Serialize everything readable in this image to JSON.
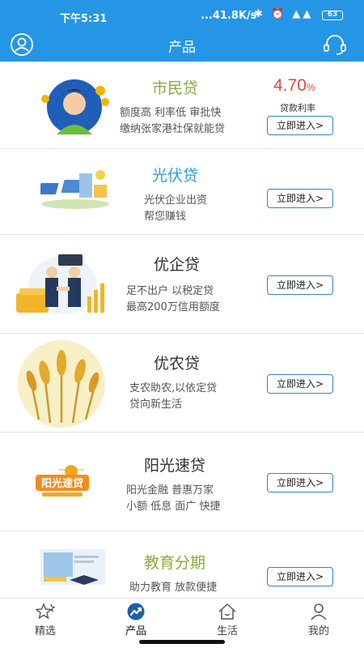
{
  "status_bar": {
    "time": "下午5:31",
    "network_speed": "...41.8K/s",
    "battery": "63"
  },
  "header": {
    "title": "产品"
  },
  "products": [
    {
      "name": "市民贷",
      "desc": [
        "额度高 利率低 审批快",
        "缴纳张家港社保就能贷"
      ],
      "button": "立即进入>",
      "rate": "4.70",
      "rate_unit": "%",
      "rate_label": "贷款利率",
      "name_color": "#8aab3c"
    },
    {
      "name": "光伏贷",
      "desc": [
        "光伏企业出资",
        "帮您赚钱"
      ],
      "button": "立即进入>",
      "name_color": "#2a9fd8"
    },
    {
      "name": "优企贷",
      "desc": [
        "足不出户 以税定贷",
        "最高200万信用额度"
      ],
      "button": "立即进入>",
      "name_color": "#333333"
    },
    {
      "name": "优农贷",
      "desc": [
        "支农助农,以依定贷",
        "贷向新生活"
      ],
      "button": "立即进入>",
      "name_color": "#333333"
    },
    {
      "name": "阳光速贷",
      "desc": [
        "阳光金融 普惠万家",
        "小额 低息 面广 快捷"
      ],
      "button": "立即进入>",
      "logo_text": "阳光速贷",
      "name_color": "#333333"
    },
    {
      "name": "教育分期",
      "desc": [
        "助力教育 放款便捷"
      ],
      "button": "立即进入>",
      "name_color": "#8aab3c"
    }
  ],
  "tabbar": {
    "items": [
      {
        "label": "精选",
        "icon": "star-icon"
      },
      {
        "label": "产品",
        "icon": "product-icon",
        "active": true
      },
      {
        "label": "生活",
        "icon": "house-icon"
      },
      {
        "label": "我的",
        "icon": "person-icon"
      }
    ]
  },
  "colors": {
    "primary": "#2596e6",
    "rate": "#e04848",
    "button_border": "#2e86c9",
    "accent_green": "#8aab3c"
  }
}
